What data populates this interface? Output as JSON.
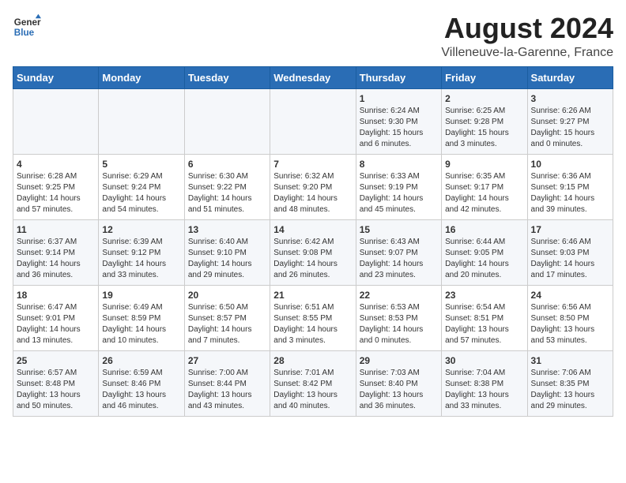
{
  "logo": {
    "line1": "General",
    "line2": "Blue"
  },
  "title": "August 2024",
  "subtitle": "Villeneuve-la-Garenne, France",
  "days_of_week": [
    "Sunday",
    "Monday",
    "Tuesday",
    "Wednesday",
    "Thursday",
    "Friday",
    "Saturday"
  ],
  "weeks": [
    [
      {
        "day": "",
        "info": ""
      },
      {
        "day": "",
        "info": ""
      },
      {
        "day": "",
        "info": ""
      },
      {
        "day": "",
        "info": ""
      },
      {
        "day": "1",
        "info": "Sunrise: 6:24 AM\nSunset: 9:30 PM\nDaylight: 15 hours and 6 minutes."
      },
      {
        "day": "2",
        "info": "Sunrise: 6:25 AM\nSunset: 9:28 PM\nDaylight: 15 hours and 3 minutes."
      },
      {
        "day": "3",
        "info": "Sunrise: 6:26 AM\nSunset: 9:27 PM\nDaylight: 15 hours and 0 minutes."
      }
    ],
    [
      {
        "day": "4",
        "info": "Sunrise: 6:28 AM\nSunset: 9:25 PM\nDaylight: 14 hours and 57 minutes."
      },
      {
        "day": "5",
        "info": "Sunrise: 6:29 AM\nSunset: 9:24 PM\nDaylight: 14 hours and 54 minutes."
      },
      {
        "day": "6",
        "info": "Sunrise: 6:30 AM\nSunset: 9:22 PM\nDaylight: 14 hours and 51 minutes."
      },
      {
        "day": "7",
        "info": "Sunrise: 6:32 AM\nSunset: 9:20 PM\nDaylight: 14 hours and 48 minutes."
      },
      {
        "day": "8",
        "info": "Sunrise: 6:33 AM\nSunset: 9:19 PM\nDaylight: 14 hours and 45 minutes."
      },
      {
        "day": "9",
        "info": "Sunrise: 6:35 AM\nSunset: 9:17 PM\nDaylight: 14 hours and 42 minutes."
      },
      {
        "day": "10",
        "info": "Sunrise: 6:36 AM\nSunset: 9:15 PM\nDaylight: 14 hours and 39 minutes."
      }
    ],
    [
      {
        "day": "11",
        "info": "Sunrise: 6:37 AM\nSunset: 9:14 PM\nDaylight: 14 hours and 36 minutes."
      },
      {
        "day": "12",
        "info": "Sunrise: 6:39 AM\nSunset: 9:12 PM\nDaylight: 14 hours and 33 minutes."
      },
      {
        "day": "13",
        "info": "Sunrise: 6:40 AM\nSunset: 9:10 PM\nDaylight: 14 hours and 29 minutes."
      },
      {
        "day": "14",
        "info": "Sunrise: 6:42 AM\nSunset: 9:08 PM\nDaylight: 14 hours and 26 minutes."
      },
      {
        "day": "15",
        "info": "Sunrise: 6:43 AM\nSunset: 9:07 PM\nDaylight: 14 hours and 23 minutes."
      },
      {
        "day": "16",
        "info": "Sunrise: 6:44 AM\nSunset: 9:05 PM\nDaylight: 14 hours and 20 minutes."
      },
      {
        "day": "17",
        "info": "Sunrise: 6:46 AM\nSunset: 9:03 PM\nDaylight: 14 hours and 17 minutes."
      }
    ],
    [
      {
        "day": "18",
        "info": "Sunrise: 6:47 AM\nSunset: 9:01 PM\nDaylight: 14 hours and 13 minutes."
      },
      {
        "day": "19",
        "info": "Sunrise: 6:49 AM\nSunset: 8:59 PM\nDaylight: 14 hours and 10 minutes."
      },
      {
        "day": "20",
        "info": "Sunrise: 6:50 AM\nSunset: 8:57 PM\nDaylight: 14 hours and 7 minutes."
      },
      {
        "day": "21",
        "info": "Sunrise: 6:51 AM\nSunset: 8:55 PM\nDaylight: 14 hours and 3 minutes."
      },
      {
        "day": "22",
        "info": "Sunrise: 6:53 AM\nSunset: 8:53 PM\nDaylight: 14 hours and 0 minutes."
      },
      {
        "day": "23",
        "info": "Sunrise: 6:54 AM\nSunset: 8:51 PM\nDaylight: 13 hours and 57 minutes."
      },
      {
        "day": "24",
        "info": "Sunrise: 6:56 AM\nSunset: 8:50 PM\nDaylight: 13 hours and 53 minutes."
      }
    ],
    [
      {
        "day": "25",
        "info": "Sunrise: 6:57 AM\nSunset: 8:48 PM\nDaylight: 13 hours and 50 minutes."
      },
      {
        "day": "26",
        "info": "Sunrise: 6:59 AM\nSunset: 8:46 PM\nDaylight: 13 hours and 46 minutes."
      },
      {
        "day": "27",
        "info": "Sunrise: 7:00 AM\nSunset: 8:44 PM\nDaylight: 13 hours and 43 minutes."
      },
      {
        "day": "28",
        "info": "Sunrise: 7:01 AM\nSunset: 8:42 PM\nDaylight: 13 hours and 40 minutes."
      },
      {
        "day": "29",
        "info": "Sunrise: 7:03 AM\nSunset: 8:40 PM\nDaylight: 13 hours and 36 minutes."
      },
      {
        "day": "30",
        "info": "Sunrise: 7:04 AM\nSunset: 8:38 PM\nDaylight: 13 hours and 33 minutes."
      },
      {
        "day": "31",
        "info": "Sunrise: 7:06 AM\nSunset: 8:35 PM\nDaylight: 13 hours and 29 minutes."
      }
    ]
  ]
}
